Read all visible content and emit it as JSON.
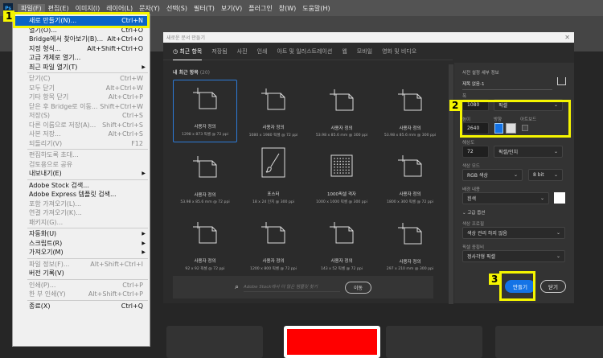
{
  "menubar": {
    "app_icon": "Ps",
    "items": [
      "파일(F)",
      "편집(E)",
      "이미지(I)",
      "레이어(L)",
      "문자(Y)",
      "선택(S)",
      "필터(T)",
      "보기(V)",
      "플러그인",
      "창(W)",
      "도움말(H)"
    ]
  },
  "file_menu": [
    {
      "label": "새로 만들기(N)...",
      "shortcut": "Ctrl+N",
      "hl": true
    },
    {
      "label": "열기(O)...",
      "shortcut": "Ctrl+O"
    },
    {
      "label": "Bridge에서 찾아보기(B)...",
      "shortcut": "Alt+Ctrl+O"
    },
    {
      "label": "지정 형식...",
      "shortcut": "Alt+Shift+Ctrl+O"
    },
    {
      "label": "고급 개체로 열기...",
      "shortcut": ""
    },
    {
      "label": "최근 파일 열기(T)",
      "shortcut": "",
      "sub": true
    },
    {
      "sep": true
    },
    {
      "label": "닫기(C)",
      "shortcut": "Ctrl+W",
      "dis": true
    },
    {
      "label": "모두 닫기",
      "shortcut": "Alt+Ctrl+W",
      "dis": true
    },
    {
      "label": "기타 항목 닫기",
      "shortcut": "Alt+Ctrl+P",
      "dis": true
    },
    {
      "label": "닫은 후 Bridge로 이동...",
      "shortcut": "Shift+Ctrl+W",
      "dis": true
    },
    {
      "label": "저장(S)",
      "shortcut": "Ctrl+S",
      "dis": true
    },
    {
      "label": "다른 이름으로 저장(A)...",
      "shortcut": "Shift+Ctrl+S",
      "dis": true
    },
    {
      "label": "사본 저장...",
      "shortcut": "Alt+Ctrl+S",
      "dis": true
    },
    {
      "label": "되돌리기(V)",
      "shortcut": "F12",
      "dis": true
    },
    {
      "sep": true
    },
    {
      "label": "편집하도록 초대...",
      "shortcut": "",
      "dis": true
    },
    {
      "label": "검토용으로 공유",
      "shortcut": "",
      "dis": true
    },
    {
      "label": "내보내기(E)",
      "shortcut": "",
      "sub": true
    },
    {
      "sep": true
    },
    {
      "label": "Adobe Stock 검색...",
      "shortcut": ""
    },
    {
      "label": "Adobe Express 템플릿 검색...",
      "shortcut": ""
    },
    {
      "label": "포함 가져오기(L)...",
      "shortcut": "",
      "dis": true
    },
    {
      "label": "연결 가져오기(K)...",
      "shortcut": "",
      "dis": true
    },
    {
      "label": "패키지(G)...",
      "shortcut": "",
      "dis": true
    },
    {
      "sep": true
    },
    {
      "label": "자동화(U)",
      "shortcut": "",
      "sub": true
    },
    {
      "label": "스크립트(R)",
      "shortcut": "",
      "sub": true
    },
    {
      "label": "가져오기(M)",
      "shortcut": "",
      "sub": true
    },
    {
      "sep": true
    },
    {
      "label": "파일 정보(F)...",
      "shortcut": "Alt+Shift+Ctrl+I",
      "dis": true
    },
    {
      "label": "버전 기록(V)",
      "shortcut": ""
    },
    {
      "sep": true
    },
    {
      "label": "인쇄(P)...",
      "shortcut": "Ctrl+P",
      "dis": true
    },
    {
      "label": "한 부 인쇄(Y)",
      "shortcut": "Alt+Shift+Ctrl+P",
      "dis": true
    },
    {
      "sep": true
    },
    {
      "label": "종료(X)",
      "shortcut": "Ctrl+Q"
    }
  ],
  "annotations": [
    "1",
    "2",
    "3"
  ],
  "dialog": {
    "title": "새로운 문서 만들기",
    "close": "✕",
    "tabs": [
      "최근 항목",
      "저장됨",
      "사진",
      "인쇄",
      "아트 및 일러스트레이션",
      "웹",
      "모바일",
      "영화 및 비디오"
    ],
    "recent_title": "내 최근 항목",
    "recent_count": "(20)",
    "presets": [
      {
        "name": "사용자 정의",
        "desc": "1298 x 873 픽셀 @ 72 ppi",
        "icon": "doc",
        "selected": true
      },
      {
        "name": "사용자 정의",
        "desc": "1080 x 1980 픽셀 @ 72 ppi",
        "icon": "doc"
      },
      {
        "name": "사용자 정의",
        "desc": "53.98 x 85.6 mm @ 300 ppi",
        "icon": "doc"
      },
      {
        "name": "사용자 정의",
        "desc": "53.98 x 85.6 mm @ 300 ppi",
        "icon": "doc"
      },
      {
        "name": "사용자 정의",
        "desc": "53.98 x 85.6 mm @ 72 ppi",
        "icon": "doc"
      },
      {
        "name": "포스터",
        "desc": "18 x 24 인치 @ 300 ppi",
        "icon": "brush"
      },
      {
        "name": "1000픽셀 격자",
        "desc": "1000 x 1000 픽셀 @ 300 ppi",
        "icon": "grid"
      },
      {
        "name": "사용자 정의",
        "desc": "1800 x 300 픽셀 @ 72 ppi",
        "icon": "doc"
      },
      {
        "name": "사용자 정의",
        "desc": "92 x 92 픽셀 @ 72 ppi",
        "icon": "doc"
      },
      {
        "name": "사용자 정의",
        "desc": "1200 x 800 픽셀 @ 72 ppi",
        "icon": "doc"
      },
      {
        "name": "사용자 정의",
        "desc": "143 x 52 픽셀 @ 72 ppi",
        "icon": "doc"
      },
      {
        "name": "사용자 정의",
        "desc": "297 x 210 mm @ 300 ppi",
        "icon": "doc"
      }
    ],
    "search": {
      "placeholder": "Adobe Stock에서 더 많은 템플릿 찾기",
      "go": "이동"
    },
    "details": {
      "heading": "사전 설정 세부 정보",
      "doc_name": "제목 없음-1",
      "width_label": "폭",
      "width": "1080",
      "unit": "픽셀",
      "height_label": "높이",
      "height": "2640",
      "orientation_label": "방향",
      "artboard_label": "아트보드",
      "res_label": "해상도",
      "res": "72",
      "res_unit": "픽셀/인치",
      "mode_label": "색상 모드",
      "mode": "RGB 색상",
      "depth": "8 bit",
      "bg_label": "배경 내용",
      "bg": "흰색",
      "advanced": "고급 옵션",
      "profile_label": "색상 프로필",
      "profile": "색상 관리 하지 않음",
      "aspect_label": "픽셀 종횡비",
      "aspect": "정사각형 픽셀",
      "create": "만들기",
      "close": "닫기"
    }
  },
  "colors": {
    "accent": "#1473e6",
    "highlight": "#f5f500"
  }
}
